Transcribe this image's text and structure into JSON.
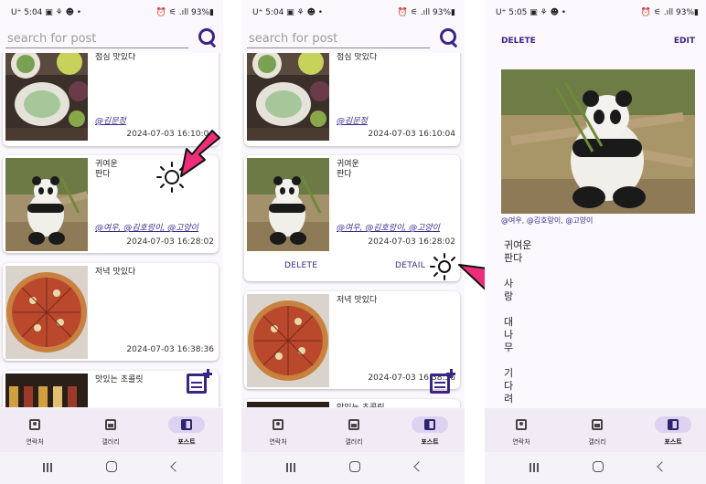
{
  "status_bar": {
    "screen1": {
      "time": "U⁺ 5:04 ▣ ⚘ ☻ •",
      "right": "⏰ ⚟ .ıll 93%▮"
    },
    "screen2": {
      "time": "U⁺ 5:04 ▣ ⚘ ☻ •",
      "right": "⏰ ⚟ .ıll 93%▮"
    },
    "screen3": {
      "time": "U⁺ 5:05 ▣ ⚘ ☻ •",
      "right": "⏰ ⚟ .ıll 93%▮"
    }
  },
  "search": {
    "placeholder": "search for post"
  },
  "posts": [
    {
      "title": "점심 맛있다",
      "tags": "@김문정",
      "date": "2024-07-03 16:10:04"
    },
    {
      "title": "귀여운\n판다",
      "tags": "@여우, @김호랑이, @고양이",
      "date": "2024-07-03 16:28:02"
    },
    {
      "title": "저녁 맛있다",
      "tags": "",
      "date": "2024-07-03 16:38:36"
    },
    {
      "title": "맛있는 초콜릿",
      "tags": "",
      "date": ""
    }
  ],
  "card_actions": {
    "delete": "DELETE",
    "detail": "DETAIL"
  },
  "nav": {
    "contacts": "연락처",
    "gallery": "갤러리",
    "post": "포스트"
  },
  "detail": {
    "delete": "DELETE",
    "edit": "EDIT",
    "tags": "@여우, @김호랑이, @고양이",
    "lines": [
      "귀여운",
      "판다",
      "",
      "사",
      "랑",
      "",
      "대",
      "나",
      "무",
      "",
      "기",
      "다",
      "려"
    ]
  },
  "icons": {
    "search": "search-icon",
    "add_post": "add-post-icon",
    "tap": "tap-indicator-icon",
    "arrow": "pink-arrow-icon"
  },
  "colors": {
    "accent": "#3a2585",
    "nav_active": "#dcd3f1",
    "arrow": "#ee2d78",
    "background": "#fbf8fd"
  }
}
